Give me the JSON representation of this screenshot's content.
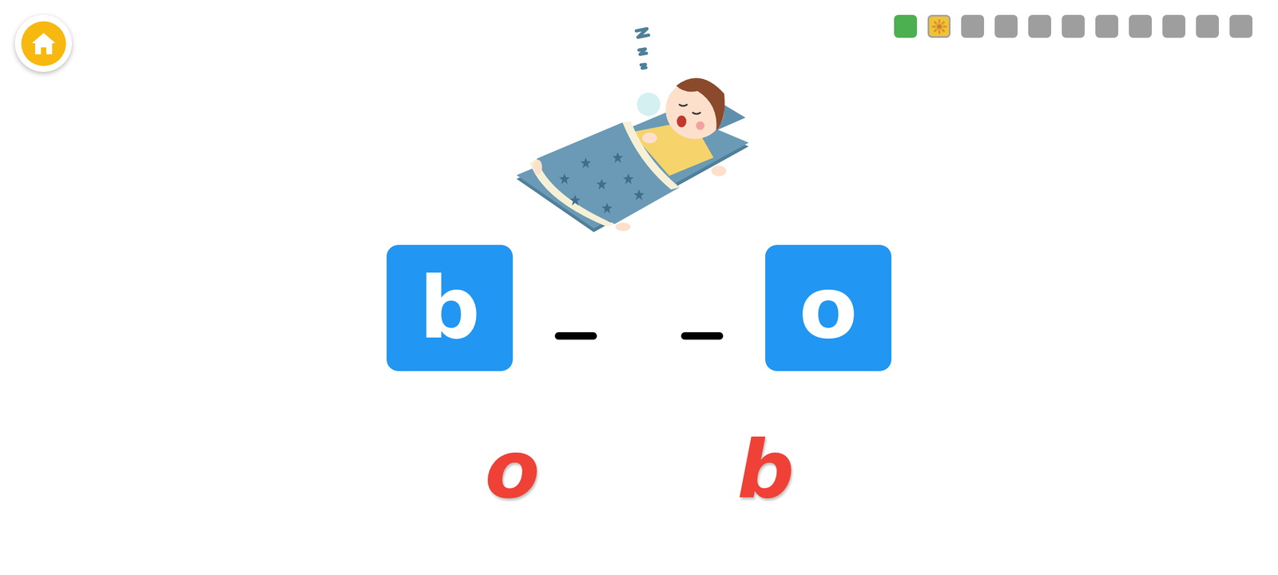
{
  "progress": [
    {
      "state": "done"
    },
    {
      "state": "current"
    },
    {
      "state": "pending"
    },
    {
      "state": "pending"
    },
    {
      "state": "pending"
    },
    {
      "state": "pending"
    },
    {
      "state": "pending"
    },
    {
      "state": "pending"
    },
    {
      "state": "pending"
    },
    {
      "state": "pending"
    },
    {
      "state": "pending"
    }
  ],
  "word": [
    {
      "kind": "tile",
      "letter": "b"
    },
    {
      "kind": "blank",
      "letter": ""
    },
    {
      "kind": "blank",
      "letter": ""
    },
    {
      "kind": "tile",
      "letter": "o"
    }
  ],
  "choices": [
    {
      "letter": "o"
    },
    {
      "letter": "b"
    }
  ]
}
